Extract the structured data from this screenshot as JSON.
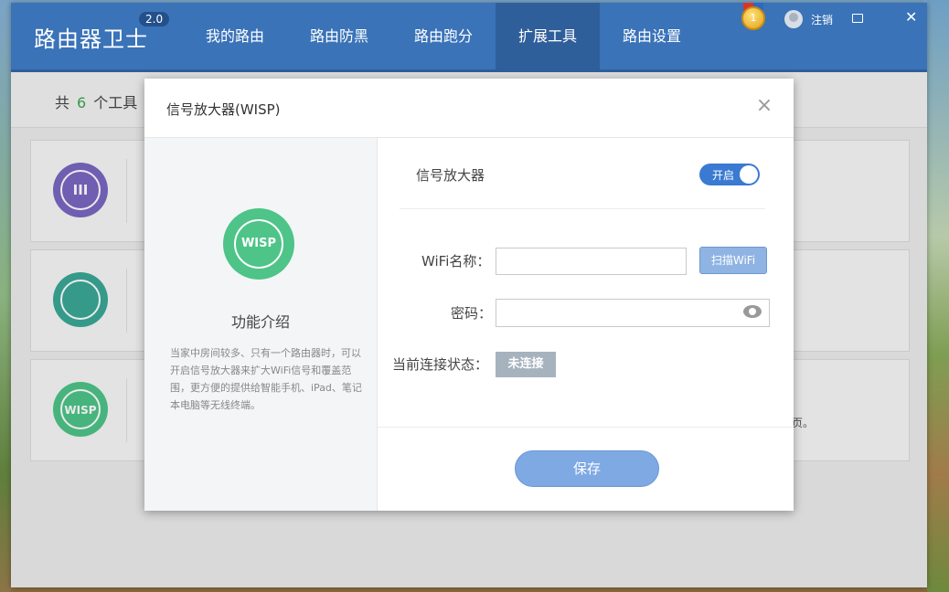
{
  "app": {
    "brand": "路由器卫士",
    "version": "2.0",
    "logout": "注销",
    "nav": [
      "我的路由",
      "路由防黑",
      "路由跑分",
      "扩展工具",
      "路由设置"
    ],
    "active_nav": "扩展工具",
    "medal_text": "1"
  },
  "toolbar": {
    "count_prefix": "共",
    "count": "6",
    "count_suffix": "个工具"
  },
  "tools": [
    {
      "icon": "menu-icon",
      "color": "#7a67c2",
      "glyph": "III"
    },
    {
      "icon": "user-icon",
      "color": "#3aa896",
      "glyph": ""
    },
    {
      "icon": "wisp-icon",
      "color": "#4ec488",
      "glyph": "WISP",
      "tail": "页。"
    }
  ],
  "dialog": {
    "title": "信号放大器(WISP)",
    "left": {
      "icon_text": "WISP",
      "intro_title": "功能介绍",
      "intro_text": "当家中房间较多、只有一个路由器时，可以开启信号放大器来扩大WiFi信号和覆盖范围，更方便的提供给智能手机、iPad、笔记本电脑等无线终端。"
    },
    "right": {
      "amp_label": "信号放大器",
      "toggle_label": "开启",
      "wifi_label": "WiFi名称：",
      "wifi_value": "",
      "scan_label": "扫描WiFi",
      "password_label": "密码：",
      "password_value": "",
      "status_label": "当前连接状态：",
      "status_value": "未连接",
      "save_label": "保存"
    }
  }
}
